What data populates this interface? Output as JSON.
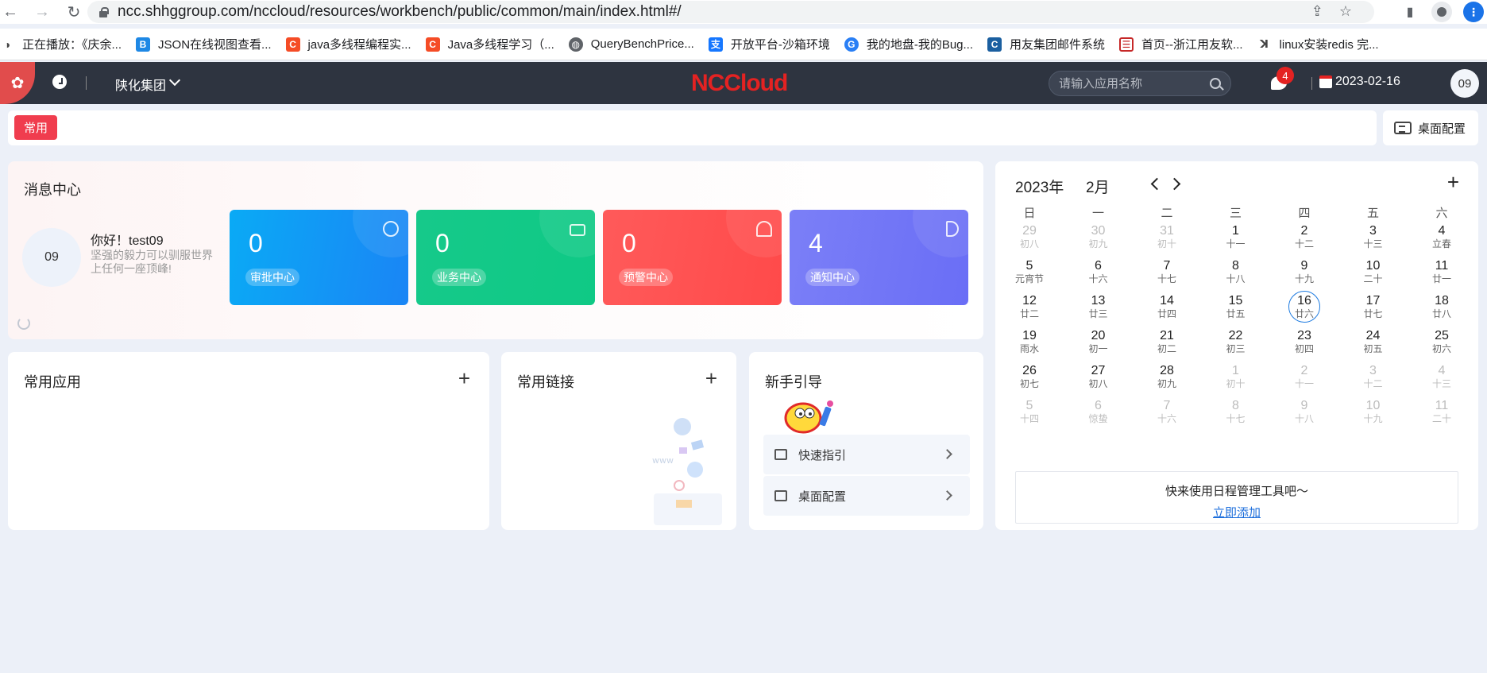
{
  "browser": {
    "url": "ncc.shhggroup.com/nccloud/resources/workbench/public/common/main/index.html#/",
    "bookmarks": [
      {
        "label": "正在播放：《庆余...",
        "icon": "play-icon"
      },
      {
        "label": "JSON在线视图查看...",
        "icon": "json-icon"
      },
      {
        "label": "java多线程编程实...",
        "icon": "csdn-icon"
      },
      {
        "label": "Java多线程学习（...",
        "icon": "csdn-icon"
      },
      {
        "label": "QueryBenchPrice...",
        "icon": "globe-icon"
      },
      {
        "label": "开放平台-沙箱环境",
        "icon": "alipay-icon"
      },
      {
        "label": "我的地盘-我的Bug...",
        "icon": "disk-icon"
      },
      {
        "label": "用友集团邮件系统",
        "icon": "mail-icon"
      },
      {
        "label": "首页--浙江用友软...",
        "icon": "home-icon"
      },
      {
        "label": "linux安装redis 完...",
        "icon": "linux-icon"
      }
    ]
  },
  "header": {
    "org": "陕化集团",
    "brand": "NCCloud",
    "search_placeholder": "请输入应用名称",
    "message_count": "4",
    "date": "2023-02-16",
    "user": "09"
  },
  "tabs": {
    "active": "常用",
    "desk_config": "桌面配置"
  },
  "message_center": {
    "title": "消息中心",
    "avatar": "09",
    "greeting": "你好！test09",
    "motto": "坚强的毅力可以驯服世界上任何一座顶峰!",
    "cards": [
      {
        "value": "0",
        "label": "审批中心"
      },
      {
        "value": "0",
        "label": "业务中心"
      },
      {
        "value": "0",
        "label": "预警中心"
      },
      {
        "value": "4",
        "label": "通知中心"
      }
    ]
  },
  "panels": {
    "apps_title": "常用应用",
    "links_title": "常用链接",
    "guide_title": "新手引导",
    "guide_items": [
      "快速指引",
      "桌面配置"
    ]
  },
  "calendar": {
    "year": "2023年",
    "month": "2月",
    "weekdays": [
      "日",
      "一",
      "二",
      "三",
      "四",
      "五",
      "六"
    ],
    "today": 16,
    "weeks": [
      [
        {
          "d": "29",
          "l": "初八",
          "o": 1
        },
        {
          "d": "30",
          "l": "初九",
          "o": 1
        },
        {
          "d": "31",
          "l": "初十",
          "o": 1
        },
        {
          "d": "1",
          "l": "十一"
        },
        {
          "d": "2",
          "l": "十二"
        },
        {
          "d": "3",
          "l": "十三"
        },
        {
          "d": "4",
          "l": "立春"
        }
      ],
      [
        {
          "d": "5",
          "l": "元宵节"
        },
        {
          "d": "6",
          "l": "十六"
        },
        {
          "d": "7",
          "l": "十七"
        },
        {
          "d": "8",
          "l": "十八"
        },
        {
          "d": "9",
          "l": "十九"
        },
        {
          "d": "10",
          "l": "二十"
        },
        {
          "d": "11",
          "l": "廿一"
        }
      ],
      [
        {
          "d": "12",
          "l": "廿二"
        },
        {
          "d": "13",
          "l": "廿三"
        },
        {
          "d": "14",
          "l": "廿四"
        },
        {
          "d": "15",
          "l": "廿五"
        },
        {
          "d": "16",
          "l": "廿六"
        },
        {
          "d": "17",
          "l": "廿七"
        },
        {
          "d": "18",
          "l": "廿八"
        }
      ],
      [
        {
          "d": "19",
          "l": "雨水"
        },
        {
          "d": "20",
          "l": "初一"
        },
        {
          "d": "21",
          "l": "初二"
        },
        {
          "d": "22",
          "l": "初三"
        },
        {
          "d": "23",
          "l": "初四"
        },
        {
          "d": "24",
          "l": "初五"
        },
        {
          "d": "25",
          "l": "初六"
        }
      ],
      [
        {
          "d": "26",
          "l": "初七"
        },
        {
          "d": "27",
          "l": "初八"
        },
        {
          "d": "28",
          "l": "初九"
        },
        {
          "d": "1",
          "l": "初十",
          "o": 1
        },
        {
          "d": "2",
          "l": "十一",
          "o": 1
        },
        {
          "d": "3",
          "l": "十二",
          "o": 1
        },
        {
          "d": "4",
          "l": "十三",
          "o": 1
        }
      ],
      [
        {
          "d": "5",
          "l": "十四",
          "o": 1
        },
        {
          "d": "6",
          "l": "惊蛰",
          "o": 1
        },
        {
          "d": "7",
          "l": "十六",
          "o": 1
        },
        {
          "d": "8",
          "l": "十七",
          "o": 1
        },
        {
          "d": "9",
          "l": "十八",
          "o": 1
        },
        {
          "d": "10",
          "l": "十九",
          "o": 1
        },
        {
          "d": "11",
          "l": "二十",
          "o": 1
        }
      ]
    ],
    "promo_text": "快来使用日程管理工具吧～",
    "promo_link": "立即添加"
  },
  "colors": {
    "header_bg": "#2e3440",
    "accent_red": "#f03d4e",
    "approve": "#1a85f5",
    "business": "#0fc985",
    "warning": "#ff4a4a",
    "notify": "#6a6ef6",
    "today_ring": "#1e7be0"
  }
}
